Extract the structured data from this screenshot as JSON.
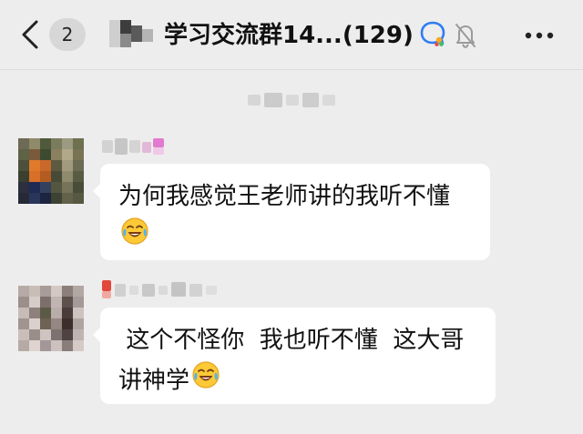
{
  "header": {
    "unread_count": "2",
    "title": "学习交流群14...(129)",
    "back_icon": "chevron-left-icon",
    "icons": [
      "group-chat-icon",
      "mute-bell-icon",
      "more-icon"
    ]
  },
  "messages": [
    {
      "text": "为何我感觉王老师讲的我听不懂",
      "emoji": "crying-laughing-emoji"
    },
    {
      "text": " 这个不怪你  我也听不懂  这大哥讲神学",
      "emoji": "crying-laughing-emoji"
    }
  ],
  "colors": {
    "background": "#ededed",
    "bubble": "#ffffff",
    "badge": "#d7d7d7",
    "group_icon_blue": "#2e7cf6"
  }
}
